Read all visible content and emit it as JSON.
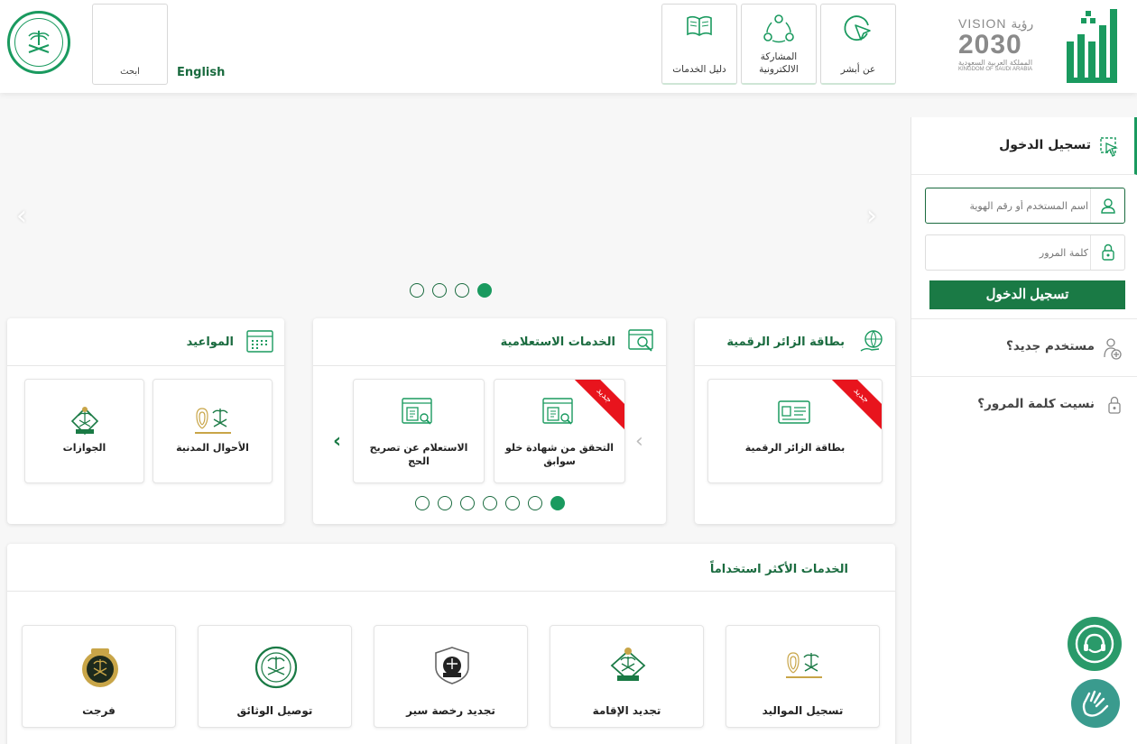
{
  "header": {
    "search_label": "ابحث",
    "language_link": "English",
    "nav": [
      {
        "label": "دليل الخدمات",
        "icon": "book-icon"
      },
      {
        "label": "المشاركة\nالالكترونية",
        "icon": "share-network-icon"
      },
      {
        "label": "عن أبشر",
        "icon": "cursor-circle-icon"
      }
    ],
    "vision": {
      "line1": "VISION رؤية",
      "line2": "2030",
      "line3": "المملكة العربية السعودية",
      "line4": "KINGDOM OF SAUDI ARABIA"
    }
  },
  "login": {
    "title": "تسجيل الدخول",
    "username_placeholder": "اسم المستخدم أو رقم الهوية",
    "password_placeholder": "كلمة المرور",
    "submit": "تسجيل الدخول",
    "new_user": "مستخدم جديد؟",
    "forgot_password": "نسيت كلمة المرور؟"
  },
  "carousel": {
    "dot_count": 4,
    "active_dot": 4
  },
  "cards": {
    "visitor": {
      "title": "بطاقة الزائر الرقمية",
      "tiles": [
        {
          "label": "بطاقة الزائر الرقمية",
          "badge": "جديد"
        }
      ]
    },
    "inquiry": {
      "title": "الخدمات الاستعلامية",
      "tiles": [
        {
          "label": "التحقق من شهادة خلو سوابق",
          "badge": "جديد"
        },
        {
          "label": "الاستعلام عن تصريح الحج",
          "badge": ""
        }
      ]
    },
    "appointments": {
      "title": "المواعيد",
      "tiles": [
        {
          "label": "الأحوال المدنية"
        },
        {
          "label": "الجوازات"
        }
      ]
    }
  },
  "most_used": {
    "title": "الخدمات الأكثر استخداماً",
    "items": [
      {
        "label": "تسجيل المواليد"
      },
      {
        "label": "تجديد الإقامة"
      },
      {
        "label": "تجديد رخصة سير"
      },
      {
        "label": "توصيل الوثائق"
      },
      {
        "label": "فرجت"
      }
    ]
  },
  "colors": {
    "primary": "#1a7a45",
    "accent": "#1a9a5f",
    "badge": "#e8141d"
  }
}
